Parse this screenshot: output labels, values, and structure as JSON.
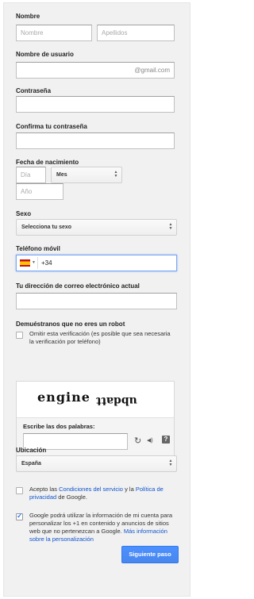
{
  "name": {
    "label": "Nombre",
    "first_placeholder": "Nombre",
    "last_placeholder": "Apellidos"
  },
  "username": {
    "label": "Nombre de usuario",
    "suffix": "@gmail.com"
  },
  "password": {
    "label": "Contraseña"
  },
  "confirm_password": {
    "label": "Confirma tu contraseña"
  },
  "birthdate": {
    "label": "Fecha de nacimiento",
    "day_placeholder": "Día",
    "month_value": "Mes",
    "year_placeholder": "Año"
  },
  "gender": {
    "label": "Sexo",
    "value": "Selecciona tu sexo"
  },
  "phone": {
    "label": "Teléfono móvil",
    "country_code": "+34"
  },
  "current_email": {
    "label": "Tu dirección de correo electrónico actual"
  },
  "robot": {
    "label": "Demuéstranos que no eres un robot",
    "skip_text": "Omitir esta verificación (es posible que sea necesaria la verificación por teléfono)",
    "captcha_word_1": "engine",
    "captcha_word_2": "ubdatt",
    "prompt": "Escribe las dos palabras:",
    "refresh_glyph": "↻",
    "audio_glyph": "◀)",
    "help_glyph": "?"
  },
  "location": {
    "label": "Ubicación",
    "value": "España"
  },
  "terms": {
    "prefix": "Acepto las ",
    "terms_link": "Condiciones del servicio",
    "middle": " y la ",
    "privacy_link": "Política de privacidad",
    "suffix": " de Google."
  },
  "personalize": {
    "text": "Google podrá utilizar la información de mi cuenta para personalizar los +1 en contenido y anuncios de sitios web que no pertenezcan a Google. ",
    "link": "Más información sobre la personalización"
  },
  "next_button": "Siguiente paso",
  "colors": {
    "accent": "#4d90fe",
    "link": "#1155cc",
    "panel": "#f1f1f1"
  }
}
